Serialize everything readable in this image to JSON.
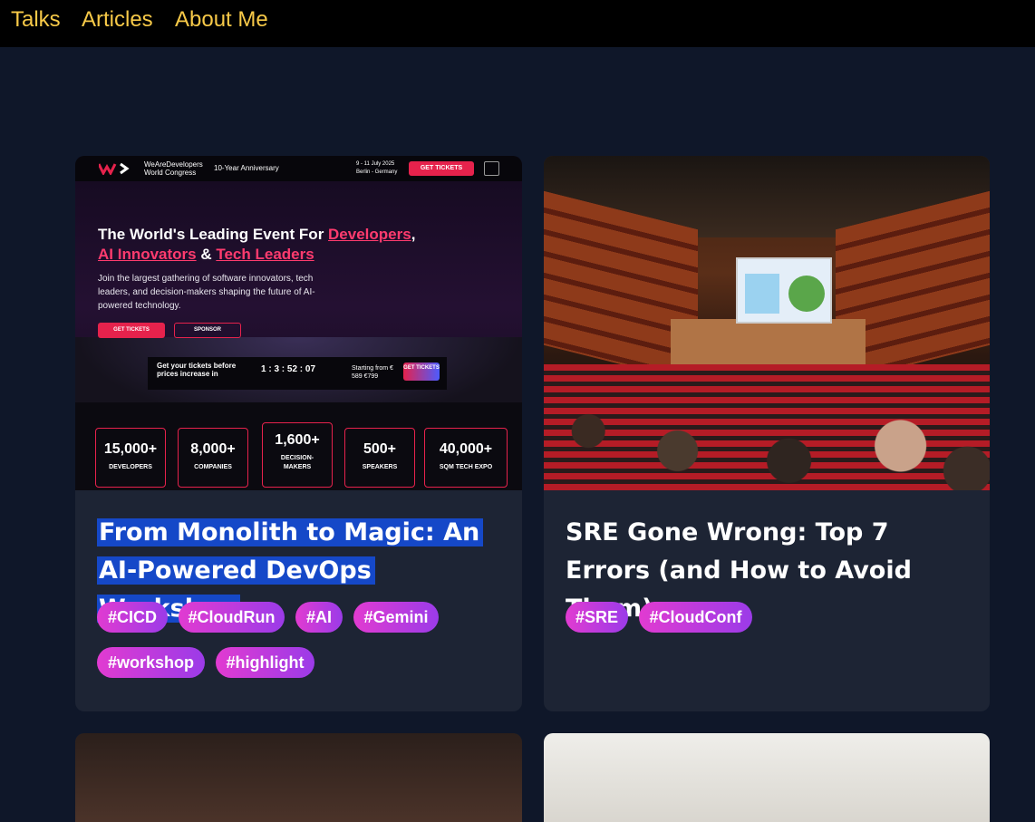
{
  "nav": {
    "talks": "Talks",
    "articles": "Articles",
    "about": "About Me"
  },
  "cards": [
    {
      "title": "From Monolith to Magic: An AI-Powered DevOps Workshop",
      "tags": [
        "#CICD",
        "#CloudRun",
        "#AI",
        "#Gemini",
        "#workshop",
        "#highlight"
      ],
      "image": {
        "brand": "WeAreDevelopers\nWorld Congress",
        "anniversary": "10-Year Anniversary",
        "dates": "9 - 11 July 2025\nBerlin - Germany",
        "cta": "GET TICKETS",
        "headline_a": "The World's Leading Event For ",
        "headline_b": "Developers",
        "headline_c": ",",
        "headline_d": "AI Innovators",
        "headline_e": " & ",
        "headline_f": "Tech Leaders",
        "sub": "Join the largest gathering of software innovators, tech leaders, and decision-makers shaping the future of AI-powered technology.",
        "btn_tickets": "GET TICKETS",
        "btn_sponsor": "SPONSOR",
        "countdown_label": "Get your tickets before prices increase in",
        "countdown": "1 : 3 : 52 : 07",
        "price": "Starting from € 589 €799",
        "price_cta": "GET TICKETS",
        "stats": [
          {
            "n": "15,000+",
            "l": "DEVELOPERS"
          },
          {
            "n": "8,000+",
            "l": "COMPANIES"
          },
          {
            "n": "1,600+",
            "l": "DECISION-MAKERS"
          },
          {
            "n": "500+",
            "l": "SPEAKERS"
          },
          {
            "n": "40,000+",
            "l": "SQM TECH EXPO"
          }
        ]
      }
    },
    {
      "title": "SRE Gone Wrong: Top 7 Errors (and How to Avoid Them)",
      "tags": [
        "#SRE",
        "#CloudConf"
      ]
    }
  ],
  "colors": {
    "nav_link": "#f7c948",
    "tag_gradient_start": "#e13bd1",
    "tag_gradient_end": "#9b3be8",
    "card_bg": "#1d2434",
    "page_bg": "#0f1729",
    "highlight": "#1548c8"
  }
}
